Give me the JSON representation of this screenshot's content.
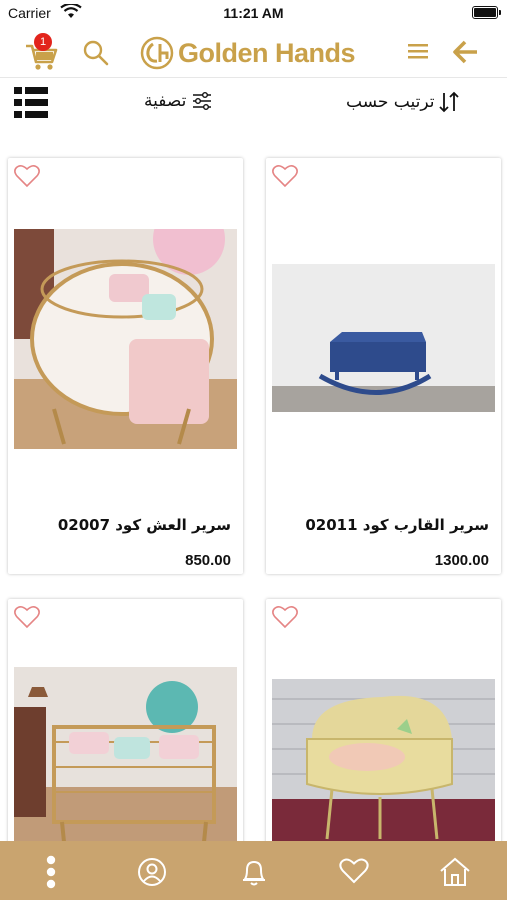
{
  "status_bar": {
    "carrier": "Carrier",
    "time": "11:21 AM",
    "battery_level": 1.0
  },
  "header": {
    "cart_icon": "cart-icon",
    "cart_count": "1",
    "search_icon": "search-icon",
    "logo_text": "Golden Hands",
    "menu_icon": "hamburger-icon",
    "back_icon": "arrow-back-icon",
    "accent_color": "#c9a14a"
  },
  "toolbar": {
    "view_icon": "list-view-icon",
    "filter_label": "تصفية",
    "filter_icon": "sliders-icon",
    "sort_label": "ترتيب حسب",
    "sort_icon": "sort-arrows-icon"
  },
  "products": [
    {
      "name": "سرير العش كود 02007",
      "price": "850.00",
      "favorite": false
    },
    {
      "name": "سرير القارب كود 02011",
      "price": "1300.00",
      "favorite": false
    },
    {
      "name": "",
      "price": "",
      "favorite": false
    },
    {
      "name": "",
      "price": "",
      "favorite": false
    }
  ],
  "tab_bar": {
    "background": "#c9a46f",
    "items": [
      {
        "icon": "more-vertical-icon"
      },
      {
        "icon": "profile-icon"
      },
      {
        "icon": "bell-icon"
      },
      {
        "icon": "heart-icon"
      },
      {
        "icon": "home-icon"
      }
    ]
  }
}
